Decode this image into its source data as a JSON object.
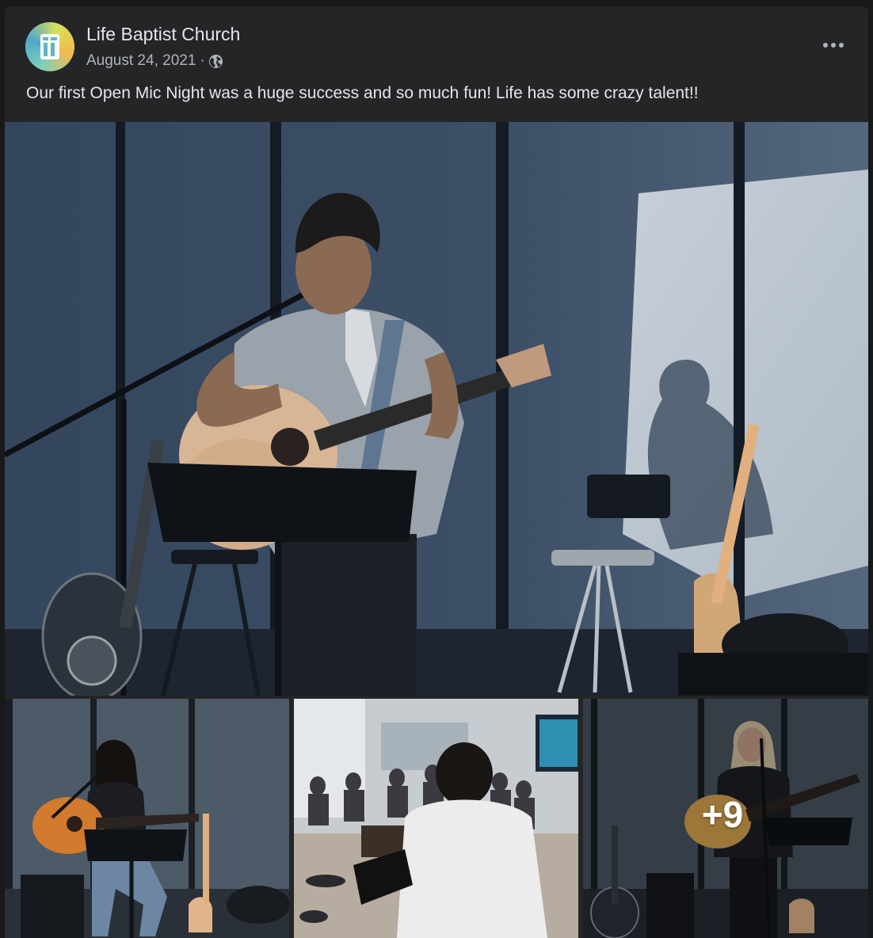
{
  "post": {
    "page_name": "Life Baptist Church",
    "date": "August 24, 2021",
    "separator": "·",
    "audience_icon": "globe-icon",
    "menu_icon": "more-horizontal-icon",
    "caption": "Our first Open Mic Night was a huge success and so much fun! Life has some crazy talent!!",
    "avatar_icon": "church-logo-icon"
  },
  "photos": {
    "more_count": "+9"
  },
  "colors": {
    "background": "#18191a",
    "card": "#242526",
    "primary_text": "#e4e6eb",
    "secondary_text": "#b0b3b8"
  }
}
